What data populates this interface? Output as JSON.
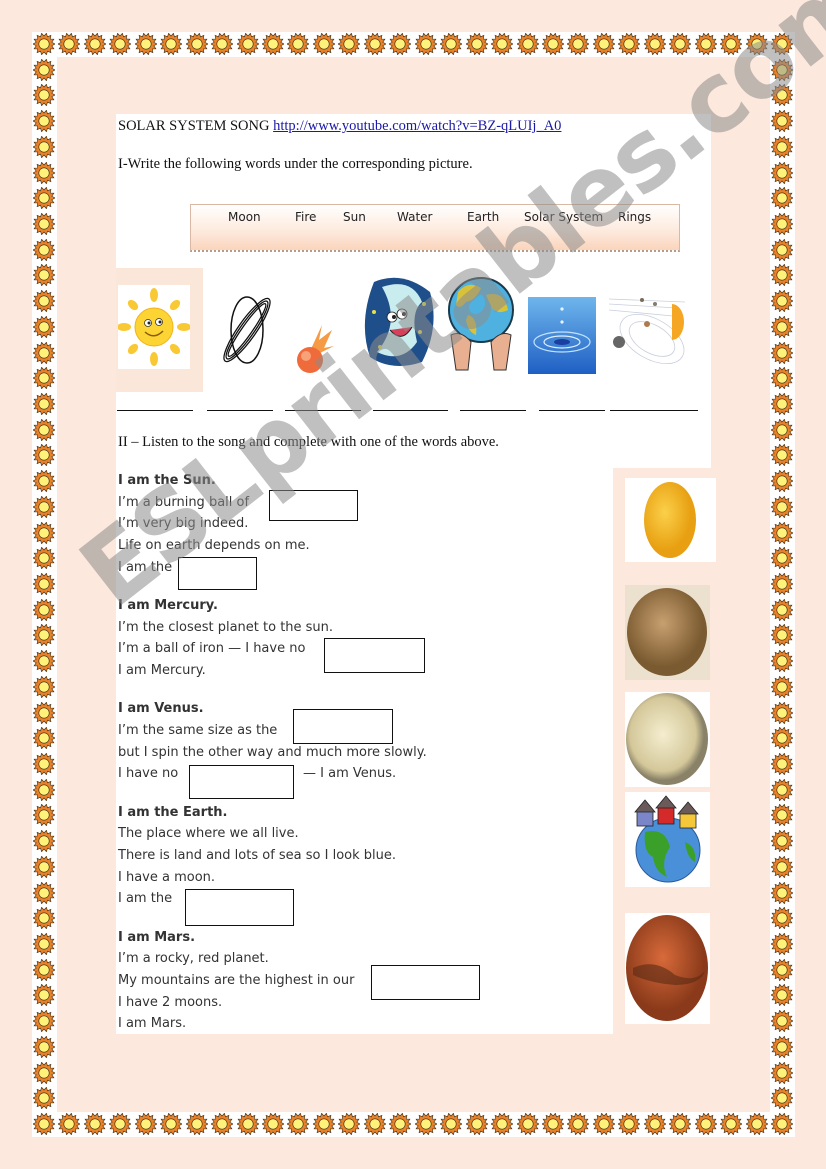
{
  "worksheet": {
    "title": "SOLAR SYSTEM SONG",
    "link": "http://www.youtube.com/watch?v=BZ-qLUIj_A0",
    "section1_instruction": "I-Write the following words under the corresponding picture.",
    "section2_instruction": "II – Listen to the song and complete with one of the words above.",
    "word_bank": [
      "Moon",
      "Fire",
      "Sun",
      "Water",
      "Earth",
      "Solar System",
      "Rings"
    ],
    "pictures": [
      {
        "icon": "sun-cartoon-icon"
      },
      {
        "icon": "ringed-planet-icon"
      },
      {
        "icon": "fireball-icon"
      },
      {
        "icon": "moon-cartoon-icon"
      },
      {
        "icon": "earth-in-hands-icon"
      },
      {
        "icon": "water-drop-icon"
      },
      {
        "icon": "solar-system-diagram-icon"
      }
    ],
    "watermark": "ESLprintables.com"
  },
  "verses": [
    {
      "heading": "I am the Sun.",
      "lines": [
        {
          "before": "I’m a burning ball of",
          "after": ""
        },
        {
          "text": "I’m very big indeed."
        },
        {
          "text": "Life on earth depends on me."
        },
        {
          "before": "I am the",
          "after": ""
        }
      ]
    },
    {
      "heading": "I am Mercury.",
      "lines": [
        {
          "text": "I’m the closest planet to the sun."
        },
        {
          "before": "I’m a ball of iron — I have no",
          "after": ""
        },
        {
          "text": "I am Mercury."
        }
      ]
    },
    {
      "heading": "I am Venus.",
      "lines": [
        {
          "before": "I’m the same size as the",
          "after": ""
        },
        {
          "text": "but I spin the other way and much more slowly."
        },
        {
          "before": "I have no",
          "after": "— I am Venus."
        }
      ]
    },
    {
      "heading": "I am the Earth.",
      "lines": [
        {
          "text": "The place where we all live."
        },
        {
          "text": "There is land and lots of sea so I look blue."
        },
        {
          "text": "I have a moon."
        },
        {
          "before": "I am the",
          "after": ""
        }
      ]
    },
    {
      "heading": "I am Mars.",
      "lines": [
        {
          "text": "I’m a rocky, red planet."
        },
        {
          "before": "My mountains are the highest in our",
          "after": ""
        },
        {
          "text": "I have 2 moons."
        },
        {
          "text": "I am Mars."
        }
      ]
    }
  ],
  "planet_images": [
    "sun-planet-icon",
    "mercury-icon",
    "venus-icon",
    "earth-with-houses-icon",
    "mars-icon"
  ],
  "colors": {
    "page_background": "#fce8dc",
    "sun_border_orange": "#e8812a",
    "sun_border_yellow": "#fff27a",
    "link_blue": "#1a1aa8"
  }
}
